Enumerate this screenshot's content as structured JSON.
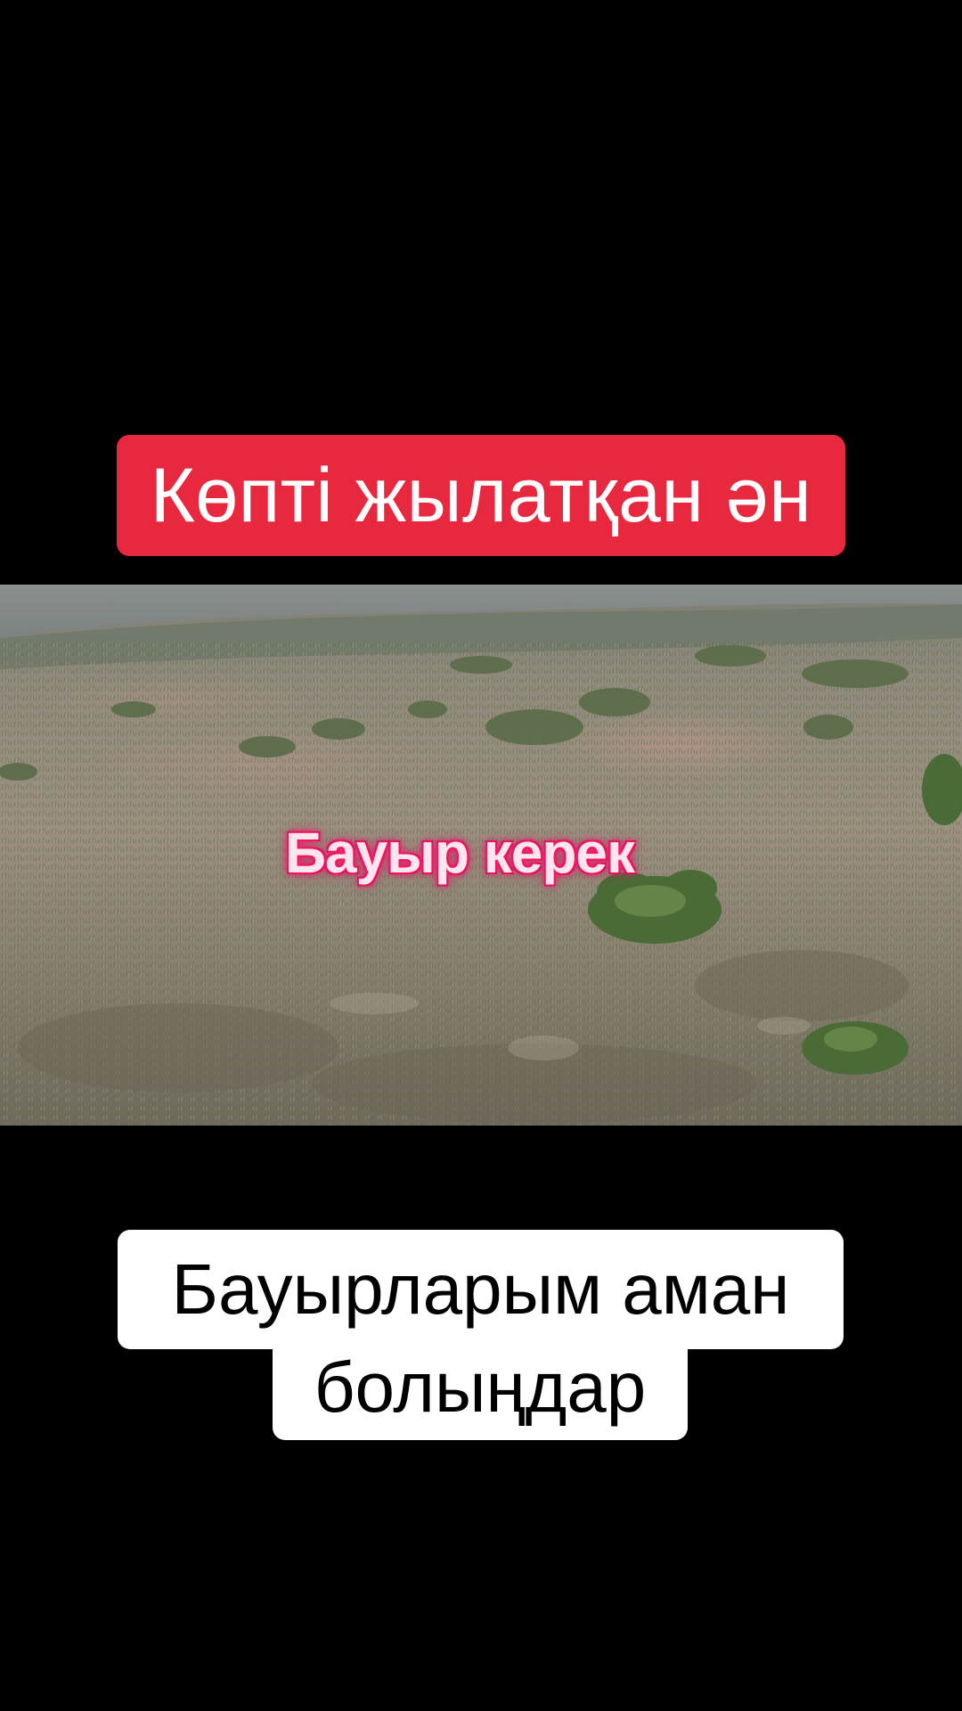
{
  "top_caption": {
    "text": "Көпті жылатқан ән",
    "background_color": "#e8283f",
    "text_color": "#ffffff"
  },
  "video": {
    "overlay_text": "Бауыр керек",
    "overlay_glow_color": "#ff1f6e"
  },
  "bottom_caption": {
    "line1": "Бауырларым аман",
    "line2": "болыңдар",
    "background_color": "#ffffff",
    "text_color": "#000000"
  }
}
